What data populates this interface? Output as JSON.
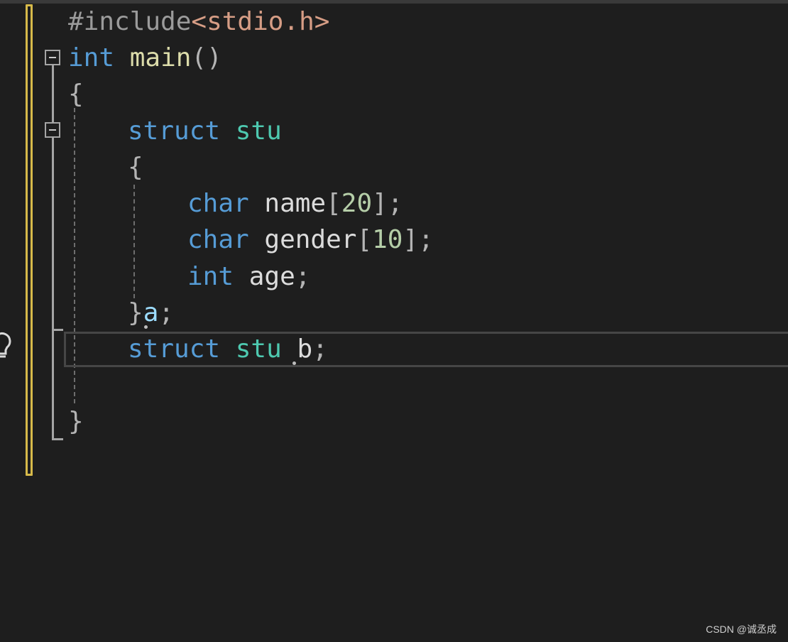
{
  "editor": {
    "lines": [
      {
        "include_directive": "#include",
        "include_header": "<stdio.h>"
      },
      {
        "kw": "int",
        "func": "main",
        "parens": "()"
      },
      {
        "brace": "{"
      },
      {
        "kw": "struct",
        "tag": "stu"
      },
      {
        "brace": "{"
      },
      {
        "kw": "char",
        "name": "name",
        "open": "[",
        "size": "20",
        "close": "];"
      },
      {
        "kw": "char",
        "name": "gender",
        "open": "[",
        "size": "10",
        "close": "];"
      },
      {
        "kw": "int",
        "name": "age",
        "end": ";"
      },
      {
        "brace": "}",
        "var": "a",
        "end": ";"
      },
      {
        "kw": "struct",
        "tag": "stu",
        "var": "b",
        "end": ";"
      },
      {
        "brace": "}"
      }
    ]
  },
  "watermark": "CSDN @诚丞成",
  "colors": {
    "background": "#1e1e1e",
    "keyword": "#569cd6",
    "type": "#4ec9b0",
    "function": "#dcdcaa",
    "string": "#d69d85",
    "number": "#b5cea8",
    "change_bar": "#d7ba4a"
  },
  "icons": [
    "collapse-icon",
    "lightbulb-icon"
  ]
}
